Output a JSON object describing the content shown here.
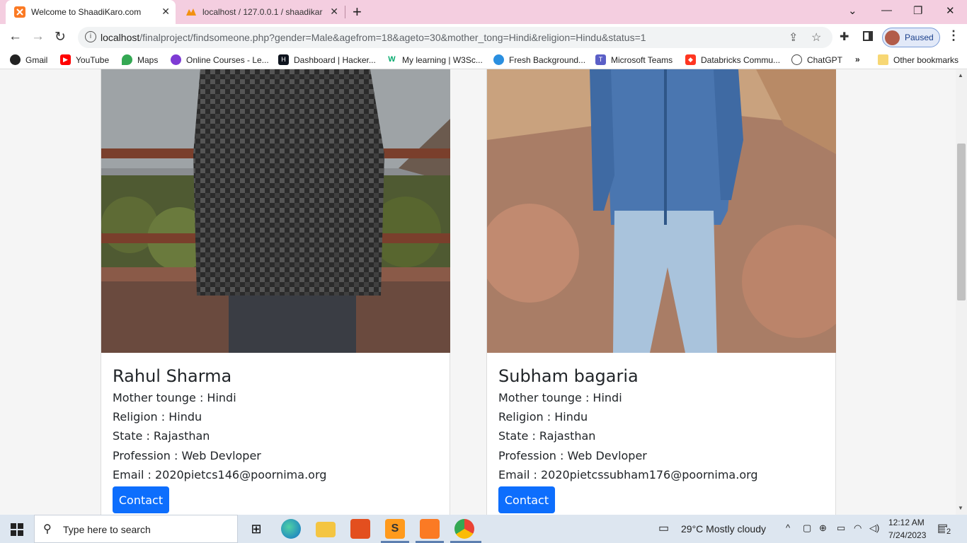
{
  "browser": {
    "tabs": [
      {
        "title": "Welcome to ShaadiKaro.com",
        "active": true
      },
      {
        "title": "localhost / 127.0.0.1 / shaadikaro",
        "active": false
      }
    ],
    "url_host": "localhost",
    "url_rest": "/finalproject/findsomeone.php?gender=Male&agefrom=18&ageto=30&mother_tong=Hindi&religion=Hindu&status=1",
    "profile_label": "Paused",
    "bookmarks": [
      {
        "label": "Gmail",
        "icon": "globe-icon"
      },
      {
        "label": "YouTube",
        "icon": "youtube-icon"
      },
      {
        "label": "Maps",
        "icon": "maps-pin-icon"
      },
      {
        "label": "Online Courses - Le...",
        "icon": "courses-icon"
      },
      {
        "label": "Dashboard | Hacker...",
        "icon": "hackerrank-icon"
      },
      {
        "label": "My learning | W3Sc...",
        "icon": "w3schools-icon"
      },
      {
        "label": "Fresh Background...",
        "icon": "globe-blue-icon"
      },
      {
        "label": "Microsoft Teams",
        "icon": "teams-icon"
      },
      {
        "label": "Databricks Commu...",
        "icon": "databricks-icon"
      },
      {
        "label": "ChatGPT",
        "icon": "chatgpt-icon"
      }
    ],
    "bookmarks_overflow": "»",
    "other_bookmarks": "Other bookmarks"
  },
  "profiles": [
    {
      "name": "Rahul Sharma",
      "mother_tongue": "Mother tounge : Hindi",
      "religion": "Religion : Hindu",
      "state": "State : Rajasthan",
      "profession": "Profession : Web Devloper",
      "email": "Email : 2020pietcs146@poornima.org",
      "button": "Contact"
    },
    {
      "name": "Subham bagaria",
      "mother_tongue": "Mother tounge : Hindi",
      "religion": "Religion : Hindu",
      "state": "State : Rajasthan",
      "profession": "Profession : Web Devloper",
      "email": "Email : 2020pietcssubham176@poornima.org",
      "button": "Contact"
    }
  ],
  "taskbar": {
    "search_placeholder": "Type here to search",
    "weather": "29°C  Mostly cloudy",
    "time": "12:12 AM",
    "date": "7/24/2023",
    "notifications": "2"
  },
  "colors": {
    "tab_strip": "#f4cee0",
    "contact_button": "#0d6efd"
  }
}
